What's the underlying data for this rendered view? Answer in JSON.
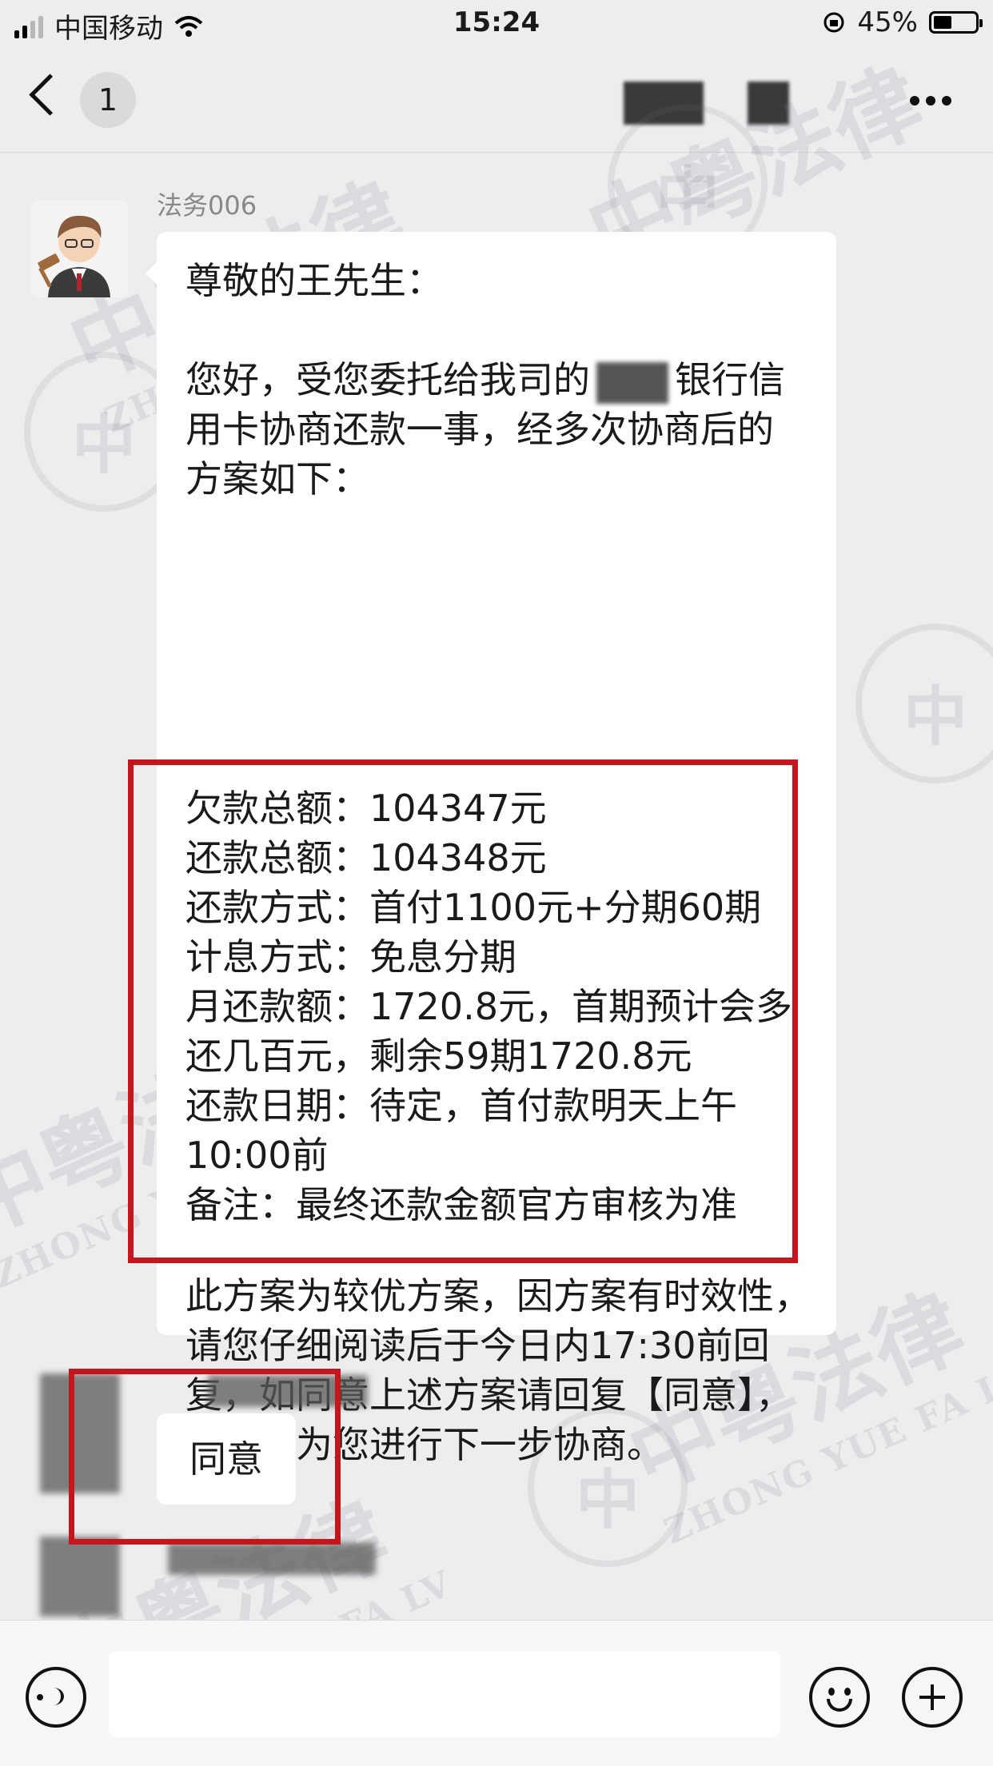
{
  "status_bar": {
    "carrier": "中国移动",
    "time": "15:24",
    "battery": "45%",
    "battery_level": 0.45
  },
  "nav": {
    "unread_count": "1"
  },
  "message": {
    "sender": "法务006",
    "greeting": "尊敬的王先生：",
    "intro_part1": "您好，受您委托给我司的",
    "intro_part2": "银行信用卡协商还款一事，经多次协商后的方案如下：",
    "plan": [
      "欠款总额：104347元",
      "还款总额：104348元",
      "还款方式：首付1100元+分期60期",
      "计息方式：免息分期",
      "月还款额：1720.8元，首期预计会多还几百元，剩余59期1720.8元",
      "还款日期：待定，首付款明天上午10:00前",
      "备注：最终还款金额官方审核为准"
    ],
    "closing": "此方案为较优方案，因方案有时效性，请您仔细阅读后于今日内17:30前回复，如同意上述方案请回复【同意】，法务将为您进行下一步协商。"
  },
  "reply": {
    "text": "同意"
  },
  "watermark": {
    "cn": "中粤法律",
    "en": "ZHONG YUE FA LV",
    "color": "#7878a0"
  },
  "colors": {
    "highlight_red": "#c4161c",
    "background": "#ededed"
  }
}
